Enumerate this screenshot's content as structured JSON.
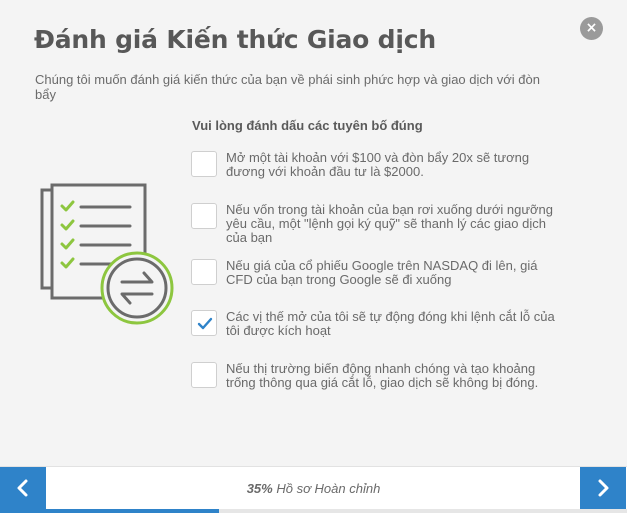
{
  "dialog": {
    "title": "Đánh giá Kiến thức Giao dịch",
    "close_glyph": "×",
    "subtitle": "Chúng tôi muốn đánh giá kiến thức của bạn về phái sinh phức hợp và giao dịch với đòn bẩy"
  },
  "question": {
    "heading": "Vui lòng đánh dấu các tuyên bố đúng",
    "options": [
      {
        "label": "Mở một tài khoản với $100 và đòn bẩy 20x sẽ tương đương với khoản đầu tư là $2000.",
        "checked": false
      },
      {
        "label": "Nếu vốn trong tài khoản của bạn rơi xuống dưới ngưỡng yêu cầu, một \"lệnh gọi ký quỹ\" sẽ thanh lý các giao dịch của bạn",
        "checked": false
      },
      {
        "label": "Nếu giá của cổ phiếu Google trên NASDAQ đi lên, giá CFD của bạn trong Google sẽ đi xuống",
        "checked": false
      },
      {
        "label": "Các vị thế mở của tôi sẽ tự động đóng khi lệnh cắt lỗ của tôi được kích hoạt",
        "checked": true
      },
      {
        "label": "Nếu thị trường biến động nhanh chóng và tạo khoảng trống thông qua giá cắt lỗ, giao dịch sẽ không bị đóng.",
        "checked": false
      }
    ]
  },
  "footer": {
    "progress_percent_label": "35%",
    "progress_label": "Hồ sơ Hoàn chỉnh",
    "progress_fraction": 0.35
  },
  "icons": {
    "close": "close-icon",
    "prev": "chevron-left-icon",
    "next": "chevron-right-icon",
    "illustration": "checklist-exchange-icon",
    "check": "checkmark-icon"
  },
  "colors": {
    "accent": "#2f83c9",
    "check_green": "#8dc63f",
    "text": "#6a6a6a",
    "title": "#585858"
  }
}
